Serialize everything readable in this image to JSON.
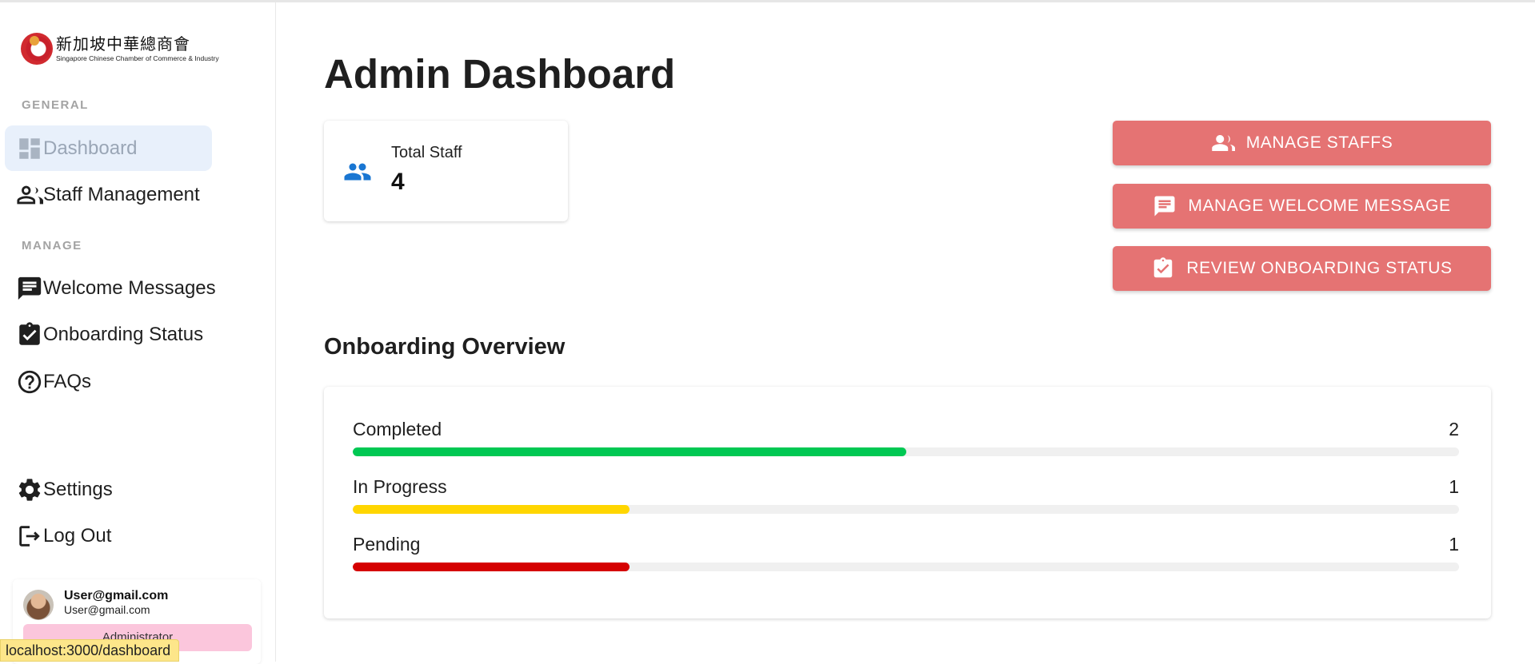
{
  "browser": {
    "status_url": "localhost:3000/dashboard"
  },
  "sidebar": {
    "logo": {
      "chinese": "新加坡中華總商會",
      "english": "Singapore Chinese Chamber of Commerce & Industry"
    },
    "sections": {
      "general": "GENERAL",
      "manage": "MANAGE"
    },
    "items": {
      "dashboard": "Dashboard",
      "staff_management": "Staff Management",
      "welcome_messages": "Welcome Messages",
      "onboarding_status": "Onboarding Status",
      "faqs": "FAQs",
      "settings": "Settings",
      "logout": "Log Out"
    },
    "user": {
      "name": "User@gmail.com",
      "email": "User@gmail.com",
      "role": "Administrator"
    }
  },
  "main": {
    "title": "Admin Dashboard",
    "stat": {
      "label": "Total Staff",
      "value": "4"
    },
    "actions": {
      "manage_staffs": "MANAGE STAFFS",
      "manage_welcome": "MANAGE WELCOME MESSAGE",
      "review_onboarding": "REVIEW ONBOARDING STATUS"
    },
    "overview": {
      "title": "Onboarding Overview",
      "rows": [
        {
          "label": "Completed",
          "count": "2",
          "fraction": 0.5,
          "color": "#00c853"
        },
        {
          "label": "In Progress",
          "count": "1",
          "fraction": 0.25,
          "color": "#ffd600"
        },
        {
          "label": "Pending",
          "count": "1",
          "fraction": 0.25,
          "color": "#d50000"
        }
      ]
    }
  },
  "colors": {
    "accent": "#e57373",
    "active_nav": "#e8f0fb",
    "stat_icon": "#1976d2",
    "role_badge": "#fbc6dc"
  }
}
